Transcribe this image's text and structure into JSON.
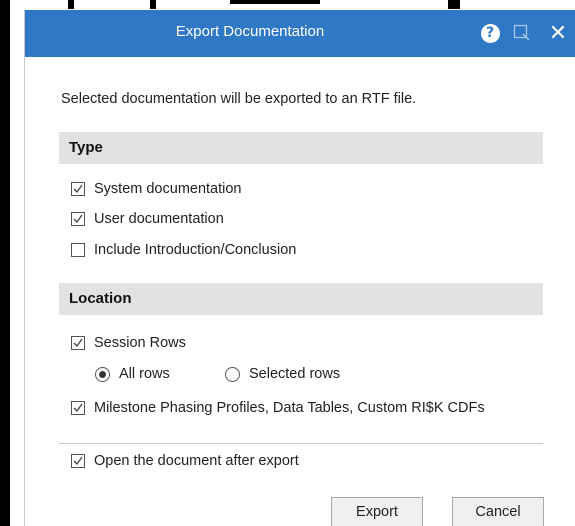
{
  "dialog": {
    "title": "Export Documentation",
    "description": "Selected documentation will be exported to an RTF file.",
    "icons": {
      "help": "help-icon",
      "screen": "screen-capture-icon",
      "close": "close-icon"
    },
    "help_glyph": "?",
    "close_glyph": "✕"
  },
  "type_section": {
    "title": "Type",
    "options": [
      {
        "label": "System documentation",
        "checked": true
      },
      {
        "label": "User documentation",
        "checked": true
      },
      {
        "label": "Include Introduction/Conclusion",
        "checked": false
      }
    ]
  },
  "location_section": {
    "title": "Location",
    "session_rows": {
      "label": "Session Rows",
      "checked": true
    },
    "rows_radio": [
      {
        "label": "All rows",
        "selected": true
      },
      {
        "label": "Selected rows",
        "selected": false
      }
    ],
    "milestone": {
      "label": "Milestone Phasing Profiles, Data Tables, Custom RI$K CDFs",
      "checked": true
    }
  },
  "open_after": {
    "label": "Open the document after export",
    "checked": true
  },
  "buttons": {
    "export": "Export",
    "cancel": "Cancel"
  },
  "colors": {
    "titlebar": "#2f78c6",
    "section_bg": "#e2e2e2"
  }
}
